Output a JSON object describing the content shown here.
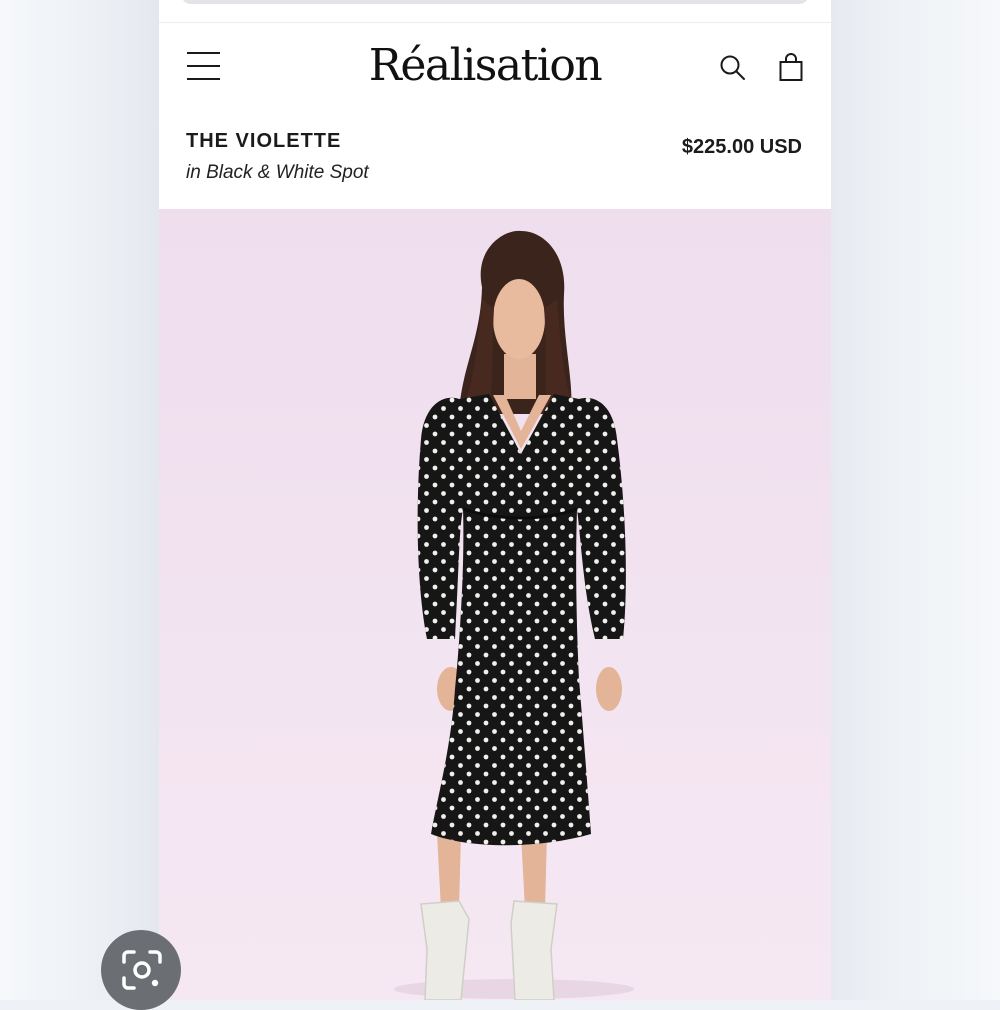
{
  "header": {
    "menu_icon": "hamburger-menu-icon",
    "brand": "Réalisation",
    "search_icon": "search-icon",
    "bag_icon": "shopping-bag-icon"
  },
  "product": {
    "name": "THE VIOLETTE",
    "color": "in Black & White Spot",
    "price": "$225.00 USD"
  },
  "overlay": {
    "lens_icon": "google-lens-icon"
  },
  "colors": {
    "hero_background": "#f2e2f0",
    "dress": "#161616",
    "dots": "#f1efe9",
    "boots": "#ecebe6"
  }
}
